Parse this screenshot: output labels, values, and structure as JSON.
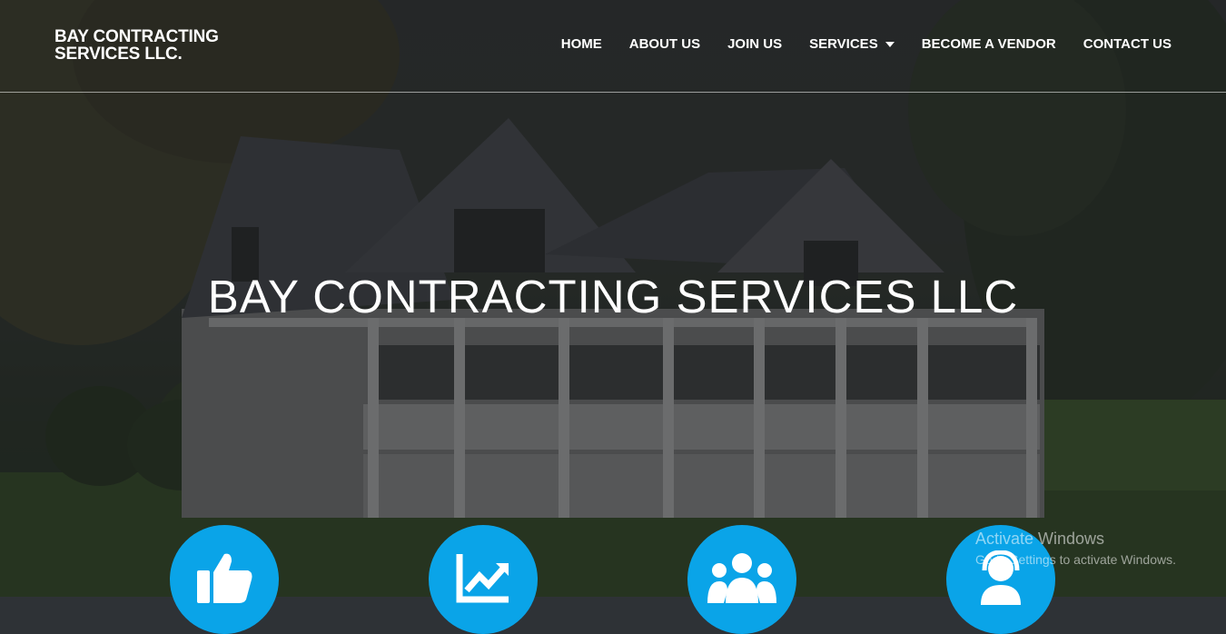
{
  "brand": {
    "line1": "BAY CONTRACTING",
    "line2": "SERVICES LLC."
  },
  "nav": {
    "home": "HOME",
    "about": "ABOUT US",
    "join": "JOIN US",
    "services": "SERVICES",
    "vendor": "BECOME A VENDOR",
    "contact": "CONTACT US"
  },
  "hero": {
    "title": "BAY CONTRACTING SERVICES LLC"
  },
  "features": [
    {
      "icon": "thumbs-up-icon"
    },
    {
      "icon": "growth-chart-icon"
    },
    {
      "icon": "team-icon"
    },
    {
      "icon": "support-agent-icon"
    }
  ],
  "watermark": {
    "title": "Activate Windows",
    "subtitle": "Go to Settings to activate Windows."
  },
  "colors": {
    "accent": "#0aa4e8",
    "text": "#ffffff"
  }
}
